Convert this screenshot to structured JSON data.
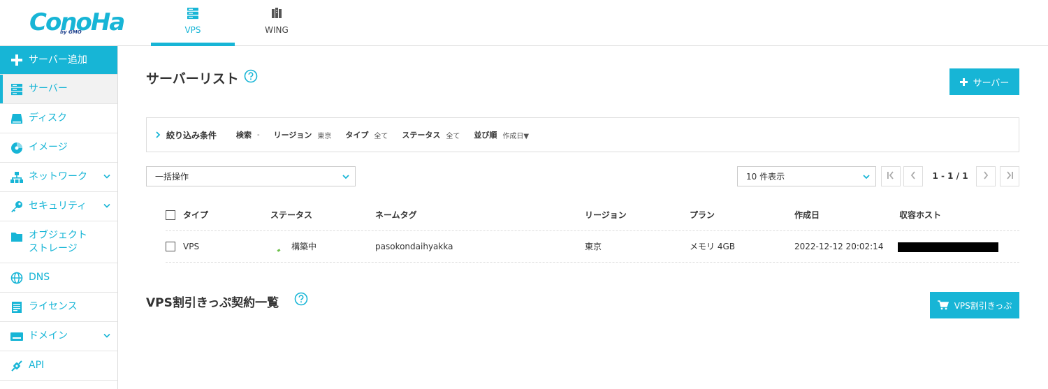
{
  "brand": {
    "logo_main": "ConoHa",
    "logo_sub": "by GMO",
    "color_accent": "#17b5d6"
  },
  "header": {
    "tabs": [
      {
        "label": "VPS",
        "icon": "server-stack-icon",
        "active": true
      },
      {
        "label": "WING",
        "icon": "wing-servers-icon",
        "active": false
      }
    ]
  },
  "sidebar": {
    "items": [
      {
        "label": "サーバー追加",
        "icon": "plus-icon"
      },
      {
        "label": "サーバー",
        "icon": "server-icon"
      },
      {
        "label": "ディスク",
        "icon": "disk-icon"
      },
      {
        "label": "イメージ",
        "icon": "disc-icon"
      },
      {
        "label": "ネットワーク",
        "icon": "network-icon",
        "has_submenu": true
      },
      {
        "label": "セキュリティ",
        "icon": "key-icon",
        "has_submenu": true
      },
      {
        "label": "オブジェクト",
        "label2": "ストレージ",
        "icon": "folder-icon"
      },
      {
        "label": "DNS",
        "icon": "globe-icon"
      },
      {
        "label": "ライセンス",
        "icon": "license-icon"
      },
      {
        "label": "ドメイン",
        "icon": "domain-icon",
        "has_submenu": true
      },
      {
        "label": "API",
        "icon": "api-icon"
      }
    ]
  },
  "main": {
    "title": "サーバーリスト",
    "add_server_label": "サーバー",
    "filter": {
      "title": "絞り込み条件",
      "search_key": "検索",
      "search_val": "-",
      "region_key": "リージョン",
      "region_val": "東京",
      "type_key": "タイプ",
      "type_val": "全て",
      "status_key": "ステータス",
      "status_val": "全て",
      "sort_key": "並び順",
      "sort_val": "作成日▼"
    },
    "bulk_action": "一括操作",
    "page_size": "10 件表示",
    "pagination": "1 - 1 / 1",
    "table": {
      "headers": {
        "type": "タイプ",
        "status": "ステータス",
        "name_tag": "ネームタグ",
        "region": "リージョン",
        "plan": "プラン",
        "created": "作成日",
        "host": "収容ホスト"
      },
      "rows": [
        {
          "type": "VPS",
          "status": "構築中",
          "name_tag": "pasokondaihyakka",
          "region": "東京",
          "plan": "メモリ 4GB",
          "created": "2022-12-12 20:02:14"
        }
      ]
    },
    "ticket_section_title": "VPS割引きっぷ契約一覧",
    "ticket_button_label": "VPS割引きっぷ"
  }
}
